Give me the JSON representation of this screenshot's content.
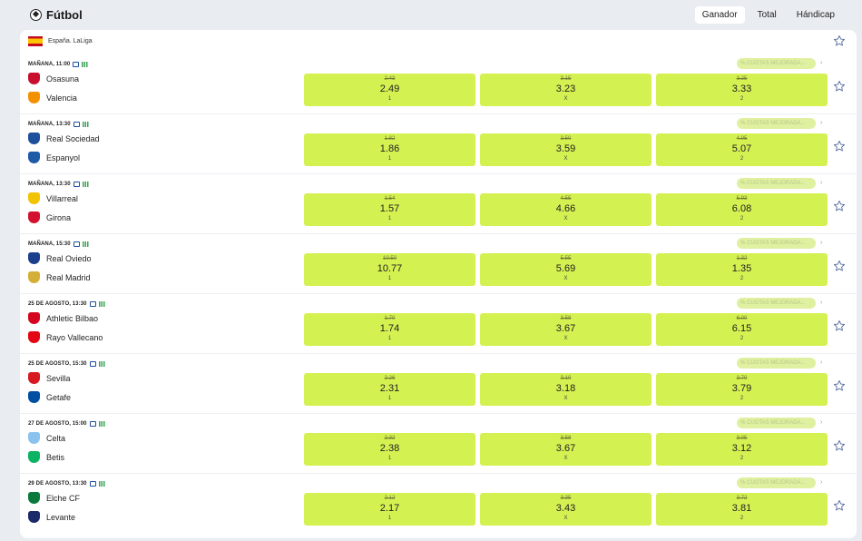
{
  "header": {
    "title": "Fútbol",
    "tabs": [
      {
        "label": "Ganador",
        "active": true
      },
      {
        "label": "Total",
        "active": false
      },
      {
        "label": "Hándicap",
        "active": false
      }
    ]
  },
  "league": {
    "name": "España. LaLiga",
    "flag": "spain-flag-icon"
  },
  "colors": {
    "odds_bg": "#d4f152",
    "promo_bg": "#dff0a0",
    "page_bg": "#e9ecf1"
  },
  "matches": [
    {
      "time": "MAÑANA, 11:00",
      "home": "Osasuna",
      "away": "Valencia",
      "home_color": "#c8102e",
      "away_color": "#f39200",
      "promo": "% CUOTAS MEJORADA...",
      "odds": [
        {
          "old": "2.43",
          "new": "2.49",
          "label": "1"
        },
        {
          "old": "3.15",
          "new": "3.23",
          "label": "X"
        },
        {
          "old": "3.25",
          "new": "3.33",
          "label": "2"
        }
      ]
    },
    {
      "time": "MAÑANA, 13:30",
      "home": "Real Sociedad",
      "away": "Espanyol",
      "home_color": "#1c4f9c",
      "away_color": "#1e5aa8",
      "promo": "% CUOTAS MEJORADA...",
      "odds": [
        {
          "old": "1.82",
          "new": "1.86",
          "label": "1"
        },
        {
          "old": "3.50",
          "new": "3.59",
          "label": "X"
        },
        {
          "old": "4.95",
          "new": "5.07",
          "label": "2"
        }
      ]
    },
    {
      "time": "MAÑANA, 13:30",
      "home": "Villarreal",
      "away": "Girona",
      "home_color": "#f2c300",
      "away_color": "#d2122e",
      "promo": "% CUOTAS MEJORADA...",
      "odds": [
        {
          "old": "1.54",
          "new": "1.57",
          "label": "1"
        },
        {
          "old": "4.55",
          "new": "4.66",
          "label": "X"
        },
        {
          "old": "5.93",
          "new": "6.08",
          "label": "2"
        }
      ]
    },
    {
      "time": "MAÑANA, 15:30",
      "home": "Real Oviedo",
      "away": "Real Madrid",
      "home_color": "#1b3f8c",
      "away_color": "#d4af37",
      "promo": "% CUOTAS MEJORADA...",
      "odds": [
        {
          "old": "10.50",
          "new": "10.77",
          "label": "1"
        },
        {
          "old": "5.55",
          "new": "5.69",
          "label": "X"
        },
        {
          "old": "1.32",
          "new": "1.35",
          "label": "2"
        }
      ]
    },
    {
      "time": "25 DE AGOSTO, 13:30",
      "home": "Athletic Bilbao",
      "away": "Rayo Vallecano",
      "home_color": "#d4061f",
      "away_color": "#e30613",
      "promo": "% CUOTAS MEJORADA...",
      "odds": [
        {
          "old": "1.70",
          "new": "1.74",
          "label": "1"
        },
        {
          "old": "3.58",
          "new": "3.67",
          "label": "X"
        },
        {
          "old": "6.00",
          "new": "6.15",
          "label": "2"
        }
      ]
    },
    {
      "time": "25 DE AGOSTO, 15:30",
      "home": "Sevilla",
      "away": "Getafe",
      "home_color": "#d71920",
      "away_color": "#004fa3",
      "promo": "% CUOTAS MEJORADA...",
      "odds": [
        {
          "old": "2.26",
          "new": "2.31",
          "label": "1"
        },
        {
          "old": "3.10",
          "new": "3.18",
          "label": "X"
        },
        {
          "old": "3.70",
          "new": "3.79",
          "label": "2"
        }
      ]
    },
    {
      "time": "27 DE AGOSTO, 15:00",
      "home": "Celta",
      "away": "Betis",
      "home_color": "#8ac3ee",
      "away_color": "#0bb363",
      "promo": "% CUOTAS MEJORADA...",
      "odds": [
        {
          "old": "2.32",
          "new": "2.38",
          "label": "1"
        },
        {
          "old": "3.58",
          "new": "3.67",
          "label": "X"
        },
        {
          "old": "3.05",
          "new": "3.12",
          "label": "2"
        }
      ]
    },
    {
      "time": "29 DE AGOSTO, 13:30",
      "home": "Elche CF",
      "away": "Levante",
      "home_color": "#0a7a3c",
      "away_color": "#1b2a6b",
      "promo": "% CUOTAS MEJORADA...",
      "odds": [
        {
          "old": "2.12",
          "new": "2.17",
          "label": "1"
        },
        {
          "old": "3.35",
          "new": "3.43",
          "label": "X"
        },
        {
          "old": "3.72",
          "new": "3.81",
          "label": "2"
        }
      ]
    }
  ]
}
